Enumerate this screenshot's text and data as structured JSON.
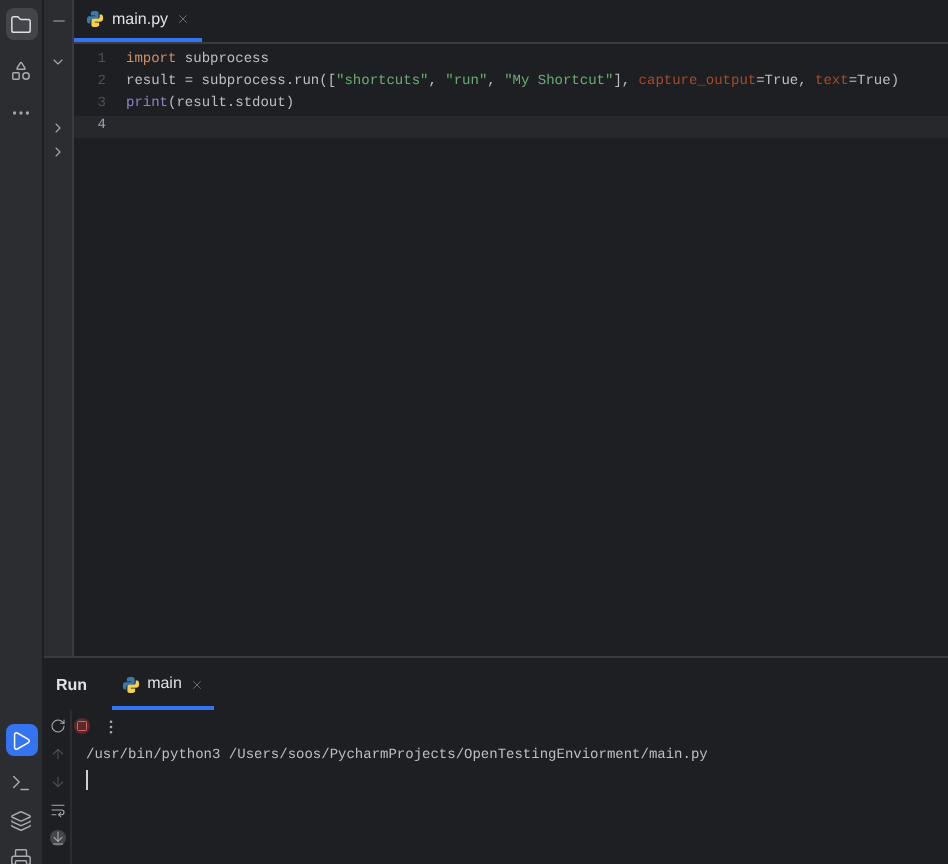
{
  "editor_tab": {
    "label": "main.py",
    "selected": true
  },
  "code_lines": [
    {
      "number": "1",
      "current": false,
      "tokens": [
        {
          "kind": "keyword",
          "text": "import"
        },
        {
          "kind": "plain",
          "text": " subprocess"
        }
      ]
    },
    {
      "number": "2",
      "current": false,
      "tokens": [
        {
          "kind": "plain",
          "text": "result = subprocess.run(["
        },
        {
          "kind": "string",
          "text": "\"shortcuts\""
        },
        {
          "kind": "plain",
          "text": ", "
        },
        {
          "kind": "string",
          "text": "\"run\""
        },
        {
          "kind": "plain",
          "text": ", "
        },
        {
          "kind": "string",
          "text": "\"My Shortcut\""
        },
        {
          "kind": "plain",
          "text": "], "
        },
        {
          "kind": "param",
          "text": "capture_output"
        },
        {
          "kind": "plain",
          "text": "=True, "
        },
        {
          "kind": "param",
          "text": "text"
        },
        {
          "kind": "plain",
          "text": "=True)"
        }
      ]
    },
    {
      "number": "3",
      "current": false,
      "tokens": [
        {
          "kind": "builtin",
          "text": "print"
        },
        {
          "kind": "plain",
          "text": "(result.stdout)"
        }
      ]
    },
    {
      "number": "4",
      "current": true
    }
  ],
  "run_panel": {
    "title": "Run",
    "tabs": [
      {
        "label": "main",
        "selected": true
      }
    ],
    "output": [
      "/usr/bin/python3 /Users/soos/PycharmProjects/OpenTestingEnviorment/main.py"
    ]
  }
}
